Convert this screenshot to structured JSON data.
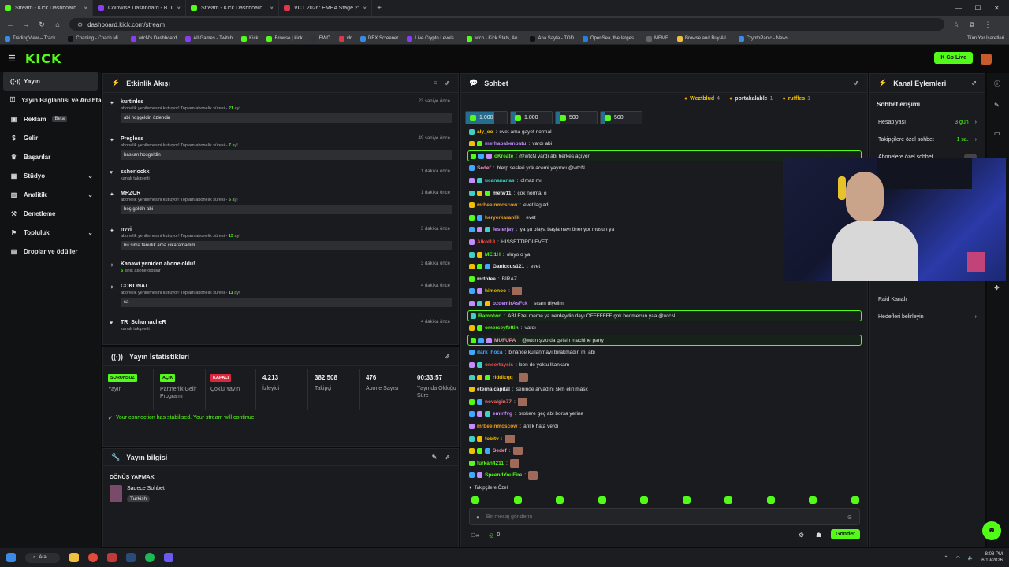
{
  "browser": {
    "tabs": [
      {
        "title": "Stream - Kick Dashboard",
        "color": "#53fc18",
        "active": true
      },
      {
        "title": "Coinwise Dashboard - BTC Crypt",
        "color": "#8a3df5",
        "active": false
      },
      {
        "title": "Stream - Kick Dashboard",
        "color": "#53fc18",
        "active": false
      },
      {
        "title": "VCT 2026: EMEA Stage 2: Brack",
        "color": "#e0364a",
        "active": false
      }
    ],
    "url": "dashboard.kick.com/stream",
    "bookmarks": [
      "TradingView – Track...",
      "Charting - Coach Mi...",
      "wtcN's Dashboard",
      "All Games - Twitch",
      "Kick",
      "Browse | kick",
      "EWC",
      "vlr",
      "DEX Screener",
      "Live Crypto Levels...",
      "wtcn - Kick Stats, An...",
      "Ana Sayfa - TOD",
      "OpenSea, the larges...",
      "MEME",
      "Browse and Buy All...",
      "CryptoPanic - News..."
    ],
    "bookmarks_right": "Tüm Yer İşaretleri"
  },
  "header": {
    "logo": "KICK",
    "go_live": "Go Live"
  },
  "sidebar": {
    "items": [
      {
        "label": "Yayın",
        "icon": "broadcast-icon",
        "selected": true,
        "chev": false
      },
      {
        "label": "Yayın Bağlantısı ve Anahtar",
        "icon": "key-icon",
        "chev": false
      },
      {
        "label": "Reklam",
        "icon": "ad-icon",
        "chev": false,
        "badge": "Beta"
      },
      {
        "label": "Gelir",
        "icon": "dollar-icon",
        "chev": false
      },
      {
        "label": "Başarılar",
        "icon": "trophy-icon",
        "chev": false
      },
      {
        "label": "Stüdyo",
        "icon": "studio-icon",
        "chev": true
      },
      {
        "label": "Analitik",
        "icon": "chart-icon",
        "chev": true
      },
      {
        "label": "Denetleme",
        "icon": "hammer-icon",
        "chev": false
      },
      {
        "label": "Topluluk",
        "icon": "community-icon",
        "chev": true
      },
      {
        "label": "Droplar ve ödüller",
        "icon": "gift-icon",
        "chev": false
      }
    ]
  },
  "activity": {
    "title": "Etkinlik Akışı",
    "items": [
      {
        "name": "kurtinles",
        "time": "23 saniye önce",
        "sub": "abonelik yenilemesini kutluyor! Toplam abonelik süresi - ",
        "months": "21",
        "suffix": " ay!",
        "msg": "abi hoşgeldin özlendin",
        "icon": "sub-icon"
      },
      {
        "name": "Pregless",
        "time": "49 saniye önce",
        "sub": "abonelik yenilemesini kutluyor! Toplam abonelik süresi - ",
        "months": "7",
        "suffix": " ay!",
        "msg": "baskan hosgeldin",
        "icon": "sub-icon"
      },
      {
        "name": "ssherlockk",
        "time": "1 dakika önce",
        "sub": "kanalı takip etti",
        "months": "",
        "suffix": "",
        "msg": "",
        "icon": "heart-icon"
      },
      {
        "name": "MRZCR",
        "time": "1 dakika önce",
        "sub": "abonelik yenilemesini kutluyor! Toplam abonelik süresi - ",
        "months": "6",
        "suffix": " ay!",
        "msg": "hoş geldin abi",
        "icon": "sub-icon"
      },
      {
        "name": "nvvi",
        "time": "3 dakika önce",
        "sub": "abonelik yenilemesini kutluyor! Toplam abonelik süresi - ",
        "months": "13",
        "suffix": " ay!",
        "msg": "bu sima tanıdık ama çıkaramadım",
        "icon": "sub-icon"
      },
      {
        "name": "Kanawi yeniden abone oldu!",
        "time": "3 dakika önce",
        "sub": "",
        "months": "5",
        "suffix": " aylık abone oldular",
        "msg": "",
        "icon": "sparkle-icon"
      },
      {
        "name": "COKONAT",
        "time": "4 dakika önce",
        "sub": "abonelik yenilemesini kutluyor! Toplam abonelik süresi - ",
        "months": "11",
        "suffix": " ay!",
        "msg": "sa",
        "icon": "sub-icon"
      },
      {
        "name": "TR_SchumacheR",
        "time": "4 dakika önce",
        "sub": "kanalı takip etti",
        "months": "",
        "suffix": "",
        "msg": "",
        "icon": "heart-icon"
      }
    ]
  },
  "stats": {
    "title": "Yayın İstatistikleri",
    "items": [
      {
        "badge": "SORUNSUZ",
        "badge_color": "#53fc18",
        "label": "Yayın"
      },
      {
        "badge": "AÇIK",
        "badge_color": "#53fc18",
        "label": "Partnerlik Gelir Programı"
      },
      {
        "badge": "KAPALI",
        "badge_color": "#e0243a",
        "label": "Çoklu Yayın"
      },
      {
        "value": "4.213",
        "label": "İzleyici"
      },
      {
        "value": "382.508",
        "label": "Takipçi"
      },
      {
        "value": "476",
        "label": "Abone Sayısı"
      },
      {
        "value": "00:33:57",
        "label": "Yayında Olduğu Süre"
      }
    ],
    "notice": "Your connection has stabilised. Your stream will continue."
  },
  "info": {
    "title": "Yayın bilgisi",
    "stream_title": "DÖNÜŞ YAPMAK",
    "category": "Sadece Sohbet",
    "tag": "Turkish"
  },
  "chat": {
    "title": "Sohbet",
    "top_gifters": [
      {
        "name": "Weztblud",
        "count": "4"
      },
      {
        "name": "portakalable",
        "count": "1"
      },
      {
        "name": "ruffles",
        "count": "1"
      }
    ],
    "goals": [
      "1.000",
      "1.000",
      "500",
      "500"
    ],
    "messages": [
      {
        "user": "aly_oo",
        "color": "#f0c000",
        "text": "evet ama gayet normal",
        "hl": false
      },
      {
        "user": "merhababenbatu",
        "color": "#c58cff",
        "text": "vardı abi",
        "hl": false
      },
      {
        "user": "oKreate",
        "color": "#53fc18",
        "text": "@wtcN vardı abi herkes açıyor",
        "hl": true
      },
      {
        "user": "Sedef",
        "color": "#ff8fb8",
        "text": "blerp sesleri yok acemi yayıncı @wtcN",
        "hl": false
      },
      {
        "user": "ucanananas",
        "color": "#3fd0c8",
        "text": "olmaz mı",
        "hl": false
      },
      {
        "user": "metw11",
        "color": "#e8e8e8",
        "text": "çok normal o",
        "hl": false
      },
      {
        "user": "mrbeeinmoscow",
        "color": "#f0a020",
        "text": "evet lagladı",
        "hl": false
      },
      {
        "user": "heryerkaranlik",
        "color": "#f0a020",
        "text": "evet",
        "hl": false
      },
      {
        "user": "festerjay",
        "color": "#c58cff",
        "text": "ya şu olaya başlamayı öneriyor musun ya",
        "hl": false
      },
      {
        "user": "Alkol18",
        "color": "#ff4d4d",
        "text": "HİSSETTİRDİ EVET",
        "hl": false
      },
      {
        "user": "MEl1H",
        "color": "#53fc18",
        "text": "oluyo o ya",
        "hl": false
      },
      {
        "user": "Ganiccus121",
        "color": "#e8e8e8",
        "text": "evet",
        "hl": false
      },
      {
        "user": "mrtotee",
        "color": "#e8e8e8",
        "text": "BİRAZ",
        "hl": false
      },
      {
        "user": "himenoo",
        "color": "#f0c000",
        "text": "",
        "hl": false
      },
      {
        "user": "ozdemirAsFck",
        "color": "#c58cff",
        "text": "scam diyelim",
        "hl": false
      },
      {
        "user": "Ramotwo",
        "color": "#53fc18",
        "text": "ABİ Ezel meme ya nerdeydin dayı OFFFFFFF çok boomersın yaa @wtcN",
        "hl": true
      },
      {
        "user": "omerseyfettin",
        "color": "#53fc18",
        "text": "vardı",
        "hl": false
      },
      {
        "user": "MUFUPA",
        "color": "#ff8fb8",
        "text": "@wtcn şizo da gelsin machine party",
        "hl": true
      },
      {
        "user": "dark_hoca",
        "color": "#3fa8ff",
        "text": "binance kullanmayı bırakmadın mı abi",
        "hl": false
      },
      {
        "user": "onsertaysis",
        "color": "#ff4d4d",
        "text": "ben de yoktu lkankam",
        "hl": false
      },
      {
        "user": "riddicqq",
        "color": "#f0c000",
        "text": "",
        "hl": false
      },
      {
        "user": "eternalcapital",
        "color": "#e8e8e8",
        "text": "seninde arvadını skm elin mask",
        "hl": false
      },
      {
        "user": "novalgin77",
        "color": "#ff6b6b",
        "text": "",
        "hl": false
      },
      {
        "user": "eminfvg",
        "color": "#c58cff",
        "text": "brokere geç abi borsa yerine",
        "hl": false
      },
      {
        "user": "mrbeeinmoscow",
        "color": "#f0a020",
        "text": "anlık hata verdi",
        "hl": false
      },
      {
        "user": "fobitv",
        "color": "#f0c000",
        "text": "",
        "hl": false
      },
      {
        "user": "Sedef",
        "color": "#ff8fb8",
        "text": "",
        "hl": false
      },
      {
        "user": "furkan4211",
        "color": "#53fc18",
        "text": "",
        "hl": false
      },
      {
        "user": "SpeendYouFire",
        "color": "#53fc18",
        "text": "",
        "hl": false
      }
    ],
    "mode": "Takipçilere Özel",
    "placeholder": "Bir mesaj gönderin",
    "points": "0",
    "send": "Gönder"
  },
  "channel": {
    "title": "Kanal Eylemleri",
    "section": "Sohbet erişimi",
    "rows": [
      {
        "label": "Hesap yaşı",
        "value": "3 gün"
      },
      {
        "label": "Takipçilere özel sohbet",
        "value": "1 sa."
      },
      {
        "label": "Abonelere özel sohbet",
        "value": ""
      }
    ],
    "raid": "Raid Kanalı",
    "goals": "Hedefleri belirleyin"
  },
  "taskbar": {
    "search": "Ara",
    "time": "8:08 PM",
    "date": "6/19/2026"
  }
}
